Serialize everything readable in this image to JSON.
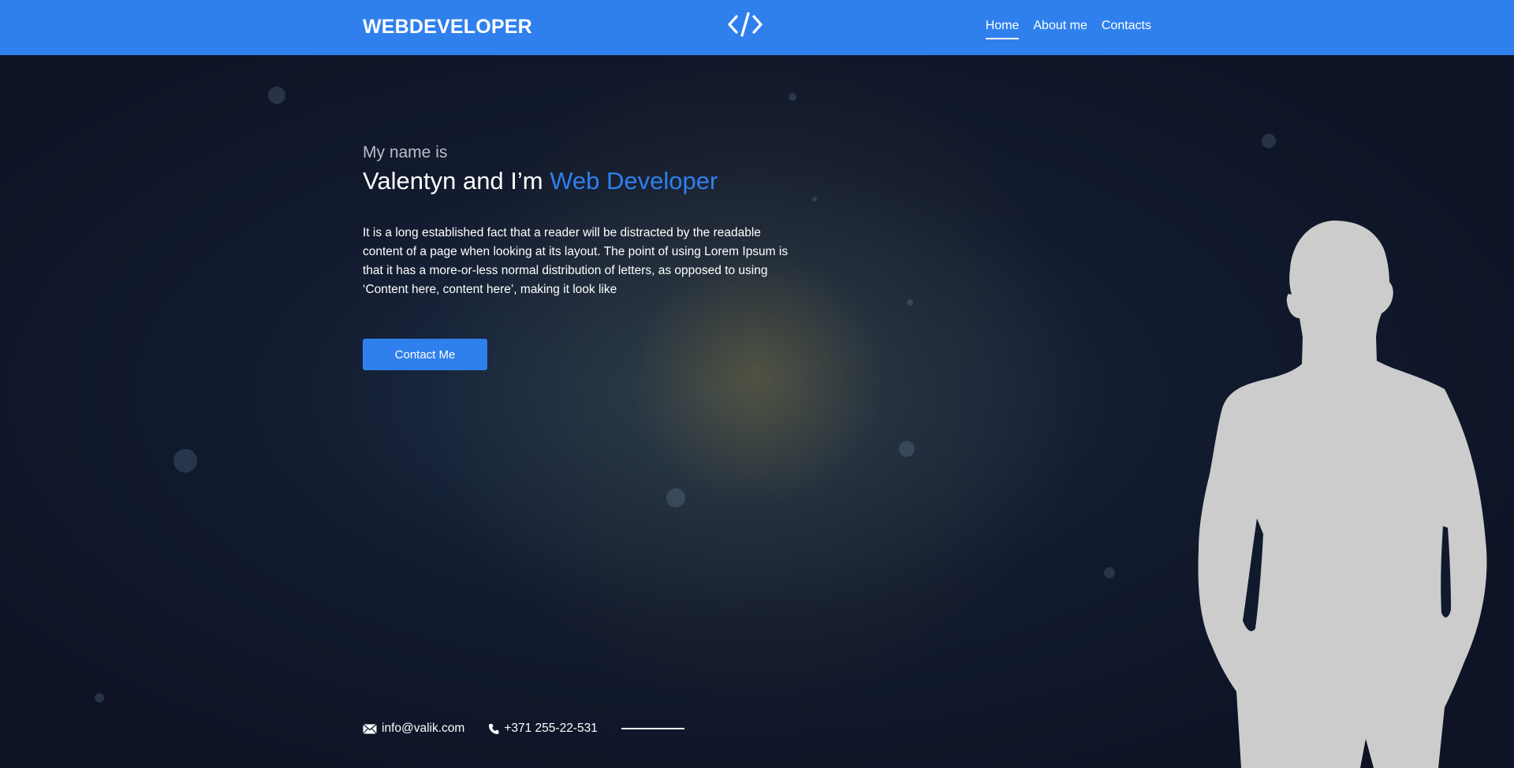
{
  "header": {
    "brand": "WEBDEVELOPER",
    "logo_icon": "code-brackets-icon",
    "nav": [
      {
        "label": "Home",
        "active": true
      },
      {
        "label": "About me",
        "active": false
      },
      {
        "label": "Contacts",
        "active": false
      }
    ]
  },
  "hero": {
    "eyebrow": "My name is",
    "headline_prefix": "Valentyn and I’m ",
    "headline_accent": "Web Developer",
    "bio": "It is a long established fact that a reader will be distracted by the readable content of a page when looking at its layout. The point of using Lorem Ipsum is that it has a more-or-less normal distribution of letters, as opposed to using ‘Content here, content here’, making it look like",
    "cta_label": "Contact Me"
  },
  "contacts": {
    "email": "info@valik.com",
    "email_icon": "envelope-icon",
    "phone": "+371 255-22-531",
    "phone_icon": "phone-icon"
  },
  "colors": {
    "accent": "#2f80ed",
    "background": "#111729",
    "silhouette": "#cccccc"
  }
}
